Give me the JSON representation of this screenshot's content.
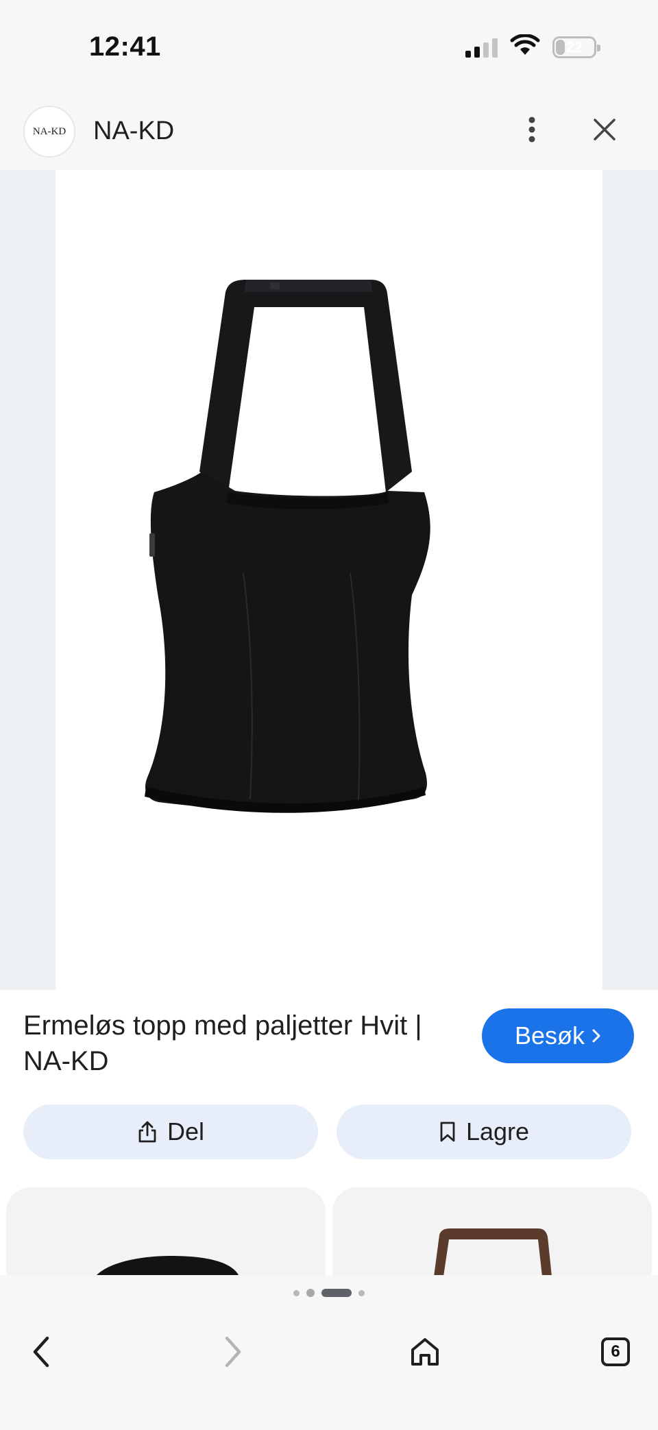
{
  "status_bar": {
    "time": "12:41",
    "battery_level": "22",
    "icons": [
      "cellular-signal-icon",
      "wifi-icon",
      "battery-icon"
    ]
  },
  "header": {
    "brand_logo_text": "NA-KD",
    "brand_name": "NA-KD",
    "icons": [
      "more-vert-icon",
      "close-icon"
    ]
  },
  "product": {
    "title": "Ermeløs topp med paljetter Hvit | NA-KD",
    "image_description": "black-halter-top-icon"
  },
  "actions": {
    "visit_label": "Besøk",
    "share_label": "Del",
    "save_label": "Lagre",
    "icons": [
      "chevron-right-icon",
      "share-icon",
      "bookmark-icon"
    ]
  },
  "bottom_nav": {
    "tab_count": "6",
    "page_indicator": {
      "count": 4,
      "active_index": 2
    },
    "icons": [
      "back-icon",
      "forward-icon",
      "home-icon",
      "tabs-icon"
    ]
  },
  "colors": {
    "accent": "#1a73e8",
    "chip_bg": "#e8eef9",
    "surface": "#f7f7f8",
    "image_bg": "#ecf0f2"
  }
}
